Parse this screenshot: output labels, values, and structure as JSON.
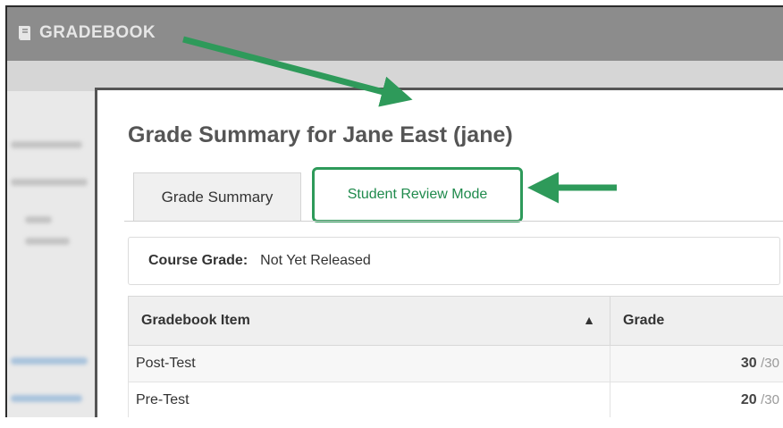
{
  "app": {
    "brand": "GRADEBOOK",
    "brand_icon": "gradebook-book-icon"
  },
  "modal": {
    "title": "Grade Summary for Jane East (jane)",
    "tabs": [
      {
        "label": "Grade Summary",
        "active": false
      },
      {
        "label": "Student Review Mode",
        "active": true
      }
    ],
    "course_grade_label": "Course Grade:",
    "course_grade_value": "Not Yet Released"
  },
  "table": {
    "headers": [
      "Gradebook Item",
      "Grade"
    ],
    "sort_icon": "chevron-up-icon",
    "rows": [
      {
        "item": "Post-Test",
        "score": "30",
        "out_of": "/30"
      },
      {
        "item": "Pre-Test",
        "score": "20",
        "out_of": "/30"
      }
    ]
  },
  "colors": {
    "highlight_green": "#2e9a5a",
    "header_gray": "#8c8c8c"
  }
}
